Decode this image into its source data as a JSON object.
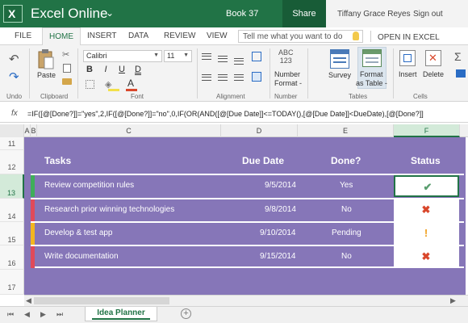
{
  "titlebar": {
    "logo_letter": "X",
    "app_name": "Excel Online",
    "doc_title": "Book 37",
    "share_label": "Share",
    "user_name": "Tiffany Grace Reyes",
    "sign_out_label": "Sign out"
  },
  "tabs": {
    "file": "FILE",
    "home": "HOME",
    "insert": "INSERT",
    "data": "DATA",
    "review": "REVIEW",
    "view": "VIEW",
    "tell_me_placeholder": "Tell me what you want to do",
    "open_in_excel": "OPEN IN EXCEL"
  },
  "ribbon": {
    "undo_label": "Undo",
    "paste_label": "Paste",
    "clipboard_label": "Clipboard",
    "font_name": "Calibri",
    "font_size": "11",
    "bold": "B",
    "italic": "I",
    "underline": "U",
    "double_underline": "D",
    "font_color_glyph": "A",
    "font_group_label": "Font",
    "alignment_label": "Alignment",
    "number_glyph": "ABC\n123",
    "number_label_1": "Number",
    "number_label_2": "Format -",
    "number_group_label": "Number",
    "survey_label": "Survey",
    "format_table_1": "Format",
    "format_table_2": "as Table -",
    "tables_group_label": "Tables",
    "insert_label": "Insert",
    "delete_label": "Delete",
    "cells_group_label": "Cells",
    "sigma_glyph": "Σ"
  },
  "formula_bar": {
    "fx": "fx",
    "formula": "=IF([@[Done?]]=\"yes\",2,IF([@[Done?]]=\"no\",0,IF(OR(AND([@[Due Date]]<=TODAY(),[@[Due Date]]<DueDate),[@[Done?]]"
  },
  "columns": [
    "A",
    "B",
    "C",
    "D",
    "E",
    "F"
  ],
  "rows": [
    "11",
    "12",
    "13",
    "14",
    "15",
    "16",
    "17"
  ],
  "table": {
    "headers": {
      "tasks": "Tasks",
      "due_date": "Due Date",
      "done": "Done?",
      "status": "Status"
    },
    "rows": [
      {
        "task": "Review competition rules",
        "due": "9/5/2014",
        "done": "Yes",
        "status_icon": "check-icon",
        "status_glyph": "✔",
        "status_color": "#5a9e6f",
        "marker_color": "#3fae5a"
      },
      {
        "task": "Research prior winning technologies",
        "due": "9/8/2014",
        "done": "No",
        "status_icon": "x-icon",
        "status_glyph": "✖",
        "status_color": "#d9472b",
        "marker_color": "#e04a5a"
      },
      {
        "task": "Develop & test app",
        "due": "9/10/2014",
        "done": "Pending",
        "status_icon": "exclamation-icon",
        "status_glyph": "!",
        "status_color": "#f0a020",
        "marker_color": "#f3b61f"
      },
      {
        "task": "Write documentation",
        "due": "9/15/2014",
        "done": "No",
        "status_icon": "x-icon",
        "status_glyph": "✖",
        "status_color": "#d9472b",
        "marker_color": "#e04a5a"
      }
    ]
  },
  "sheet": {
    "tab_name": "Idea Planner",
    "add_glyph": "+"
  },
  "colors": {
    "brand": "#217346",
    "table_bg": "#8676b8"
  }
}
